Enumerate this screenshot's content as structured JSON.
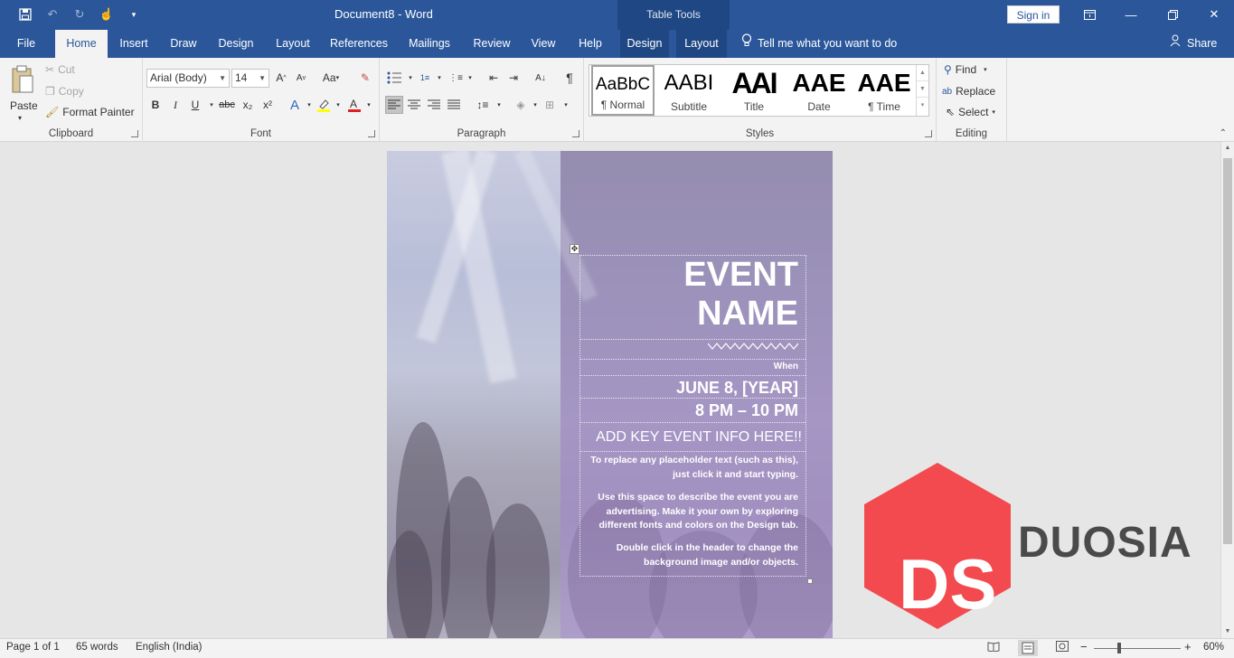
{
  "title_bar": {
    "document_title": "Document8  -  Word",
    "table_tools_label": "Table Tools",
    "sign_in_label": "Sign in",
    "qat_icons": [
      "save-icon",
      "undo-icon",
      "redo-icon",
      "touch-mode-icon",
      "customize-qat-icon"
    ]
  },
  "tabs": [
    {
      "label": "File"
    },
    {
      "label": "Home"
    },
    {
      "label": "Insert"
    },
    {
      "label": "Draw"
    },
    {
      "label": "Design"
    },
    {
      "label": "Layout"
    },
    {
      "label": "References"
    },
    {
      "label": "Mailings"
    },
    {
      "label": "Review"
    },
    {
      "label": "View"
    },
    {
      "label": "Help"
    },
    {
      "label": "Design"
    },
    {
      "label": "Layout"
    }
  ],
  "tell_me": "Tell me what you want to do",
  "share_label": "Share",
  "ribbon": {
    "clipboard": {
      "label": "Clipboard",
      "paste": "Paste",
      "cut": "Cut",
      "copy": "Copy",
      "format_painter": "Format Painter"
    },
    "font": {
      "label": "Font",
      "font_name": "Arial (Body)",
      "font_size": "14",
      "bold": "B",
      "italic": "I",
      "underline": "U",
      "strike": "abc",
      "subscript": "x₂",
      "superscript": "x²",
      "change_case": "Aa"
    },
    "paragraph": {
      "label": "Paragraph"
    },
    "styles": {
      "label": "Styles",
      "items": [
        {
          "preview": "AaBbC",
          "name": "¶ Normal"
        },
        {
          "preview": "AABI",
          "name": "Subtitle"
        },
        {
          "preview": "AAI",
          "name": "Title"
        },
        {
          "preview": "AAE",
          "name": "Date"
        },
        {
          "preview": "AAE",
          "name": "¶ Time"
        }
      ]
    },
    "editing": {
      "label": "Editing",
      "find": "Find",
      "replace": "Replace",
      "select": "Select"
    }
  },
  "flyer": {
    "event_line1": "EVENT",
    "event_line2": "NAME",
    "when": "When",
    "date": "JUNE 8, [YEAR]",
    "time": "8 PM – 10 PM",
    "key_info": "ADD KEY EVENT INFO HERE!!",
    "para1": "To replace any placeholder text (such as this), just click it and start typing.",
    "para2": "Use this space to describe the event you are advertising.  Make it your own by exploring different fonts and colors on the Design tab.",
    "para3": "Double click in the header to change the background image and/or objects."
  },
  "watermark": {
    "initials": "DS",
    "name": "DUOSIA",
    "color": "#f24a4f"
  },
  "status_bar": {
    "page": "Page 1 of 1",
    "words": "65 words",
    "language": "English (India)",
    "zoom": "60%"
  },
  "colors": {
    "accent": "#2b579a",
    "table_tools": "#1f4784"
  }
}
